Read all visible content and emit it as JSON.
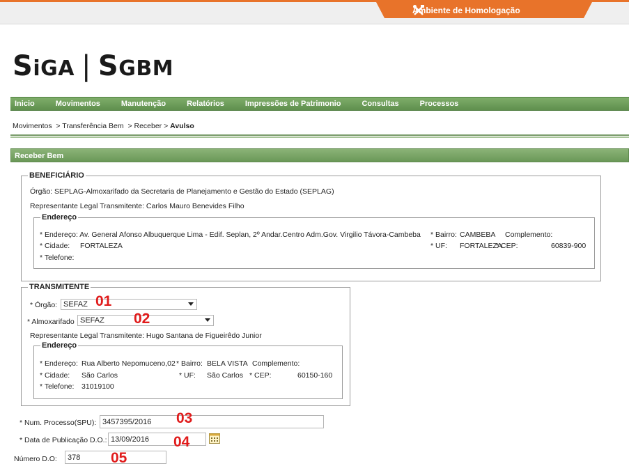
{
  "header": {
    "environment_label": "Ambiente de Homologação",
    "environment_icon": "tools-icon",
    "logo": {
      "part1_big": "S",
      "part1_small": "iGA",
      "separator": "|",
      "part2_big": "S",
      "part2_small": "GBM"
    }
  },
  "menu": [
    "Inicio",
    "Movimentos",
    "Manutenção",
    "Relatórios",
    "Impressões de Patrimonio",
    "Consultas",
    "Processos"
  ],
  "breadcrumb": {
    "trail": "Movimentos  > Transferência Bem  > Receber > ",
    "current": "Avulso"
  },
  "panel_title": "Receber Bem",
  "beneficiario": {
    "legend": "BENEFICIÁRIO",
    "orgao": "Órgão: SEPLAG-Almoxarifado da Secretaria de Planejamento e Gestão do Estado (SEPLAG)",
    "representante": "Representante Legal Transmitente: Carlos Mauro Benevides Filho",
    "endereco": {
      "legend": "Endereço",
      "endereco_line": "* Endereço: Av. General Afonso Albuquerque Lima - Edif. Seplan, 2º Andar.Centro Adm.Gov. Virgilio Távora-Cambeba",
      "bairro_label": "* Bairro:",
      "bairro_value": "CAMBEBA",
      "complemento_label": "Complemento:",
      "cidade_label": "* Cidade:",
      "cidade_value": "FORTALEZA",
      "uf_label": "* UF:",
      "uf_value": "FORTALEZA",
      "cep_label": "* CEP:",
      "cep_value": "60839-900",
      "telefone_label": "* Telefone:"
    }
  },
  "transmitente": {
    "legend": "TRANSMITENTE",
    "orgao_label": "* Órgão:",
    "orgao_value": "SEFAZ",
    "almoxarifado_label": "* Almoxarifado",
    "almoxarifado_value": "SEFAZ",
    "representante": "Representante Legal Transmitente: Hugo Santana de Figueirêdo Junior",
    "endereco": {
      "legend": "Endereço",
      "endereco_label": "* Endereço:",
      "endereco_value": "Rua Alberto Nepomuceno,02",
      "bairro_label": "* Bairro:",
      "bairro_value": "BELA VISTA",
      "complemento_label": "Complemento:",
      "cidade_label": "* Cidade:",
      "cidade_value": "São Carlos",
      "uf_label": "* UF:",
      "uf_value": "São Carlos",
      "cep_label": "* CEP:",
      "cep_value": "60150-160",
      "telefone_label": "* Telefone:",
      "telefone_value": "31019100"
    }
  },
  "form": {
    "num_processo_label": "* Num. Processo(SPU):",
    "num_processo_value": "3457395/2016",
    "data_publicacao_label": "* Data de Publicação D.O.:",
    "data_publicacao_value": "13/09/2016",
    "numero_do_label": "Número D.O:",
    "numero_do_value": "378"
  },
  "annotations": [
    "01",
    "02",
    "03",
    "04",
    "05"
  ],
  "colors": {
    "menu_green": "#6a9858",
    "accent_orange": "#e8732a",
    "annotation_red": "#e01b1b"
  }
}
